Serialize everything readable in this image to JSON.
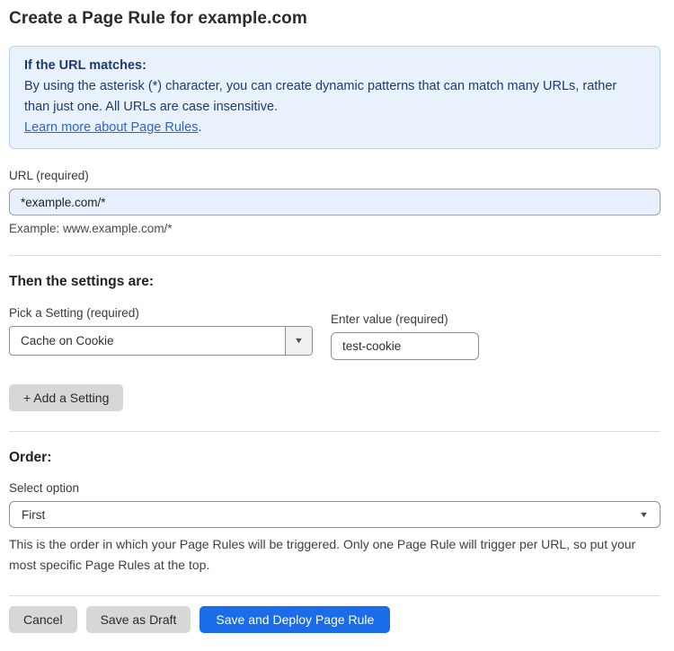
{
  "page": {
    "title": "Create a Page Rule for example.com"
  },
  "info_box": {
    "heading": "If the URL matches:",
    "body": "By using the asterisk (*) character, you can create dynamic patterns that can match many URLs, rather than just one. All URLs are case insensitive.",
    "link_label": "Learn more about Page Rules",
    "link_suffix": "."
  },
  "url_field": {
    "label": "URL (required)",
    "value": "*example.com/*",
    "example": "Example: www.example.com/*"
  },
  "settings_section": {
    "heading": "Then the settings are:",
    "setting_select": {
      "label": "Pick a Setting (required)",
      "value": "Cache on Cookie"
    },
    "value_field": {
      "label": "Enter value (required)",
      "value": "test-cookie"
    },
    "add_setting_label": "+ Add a Setting"
  },
  "order_section": {
    "heading": "Order:",
    "select_label": "Select option",
    "selected_option": "First",
    "help_text": "This is the order in which your Page Rules will be triggered. Only one Page Rule will trigger per URL, so put your most specific Page Rules at the top."
  },
  "footer": {
    "cancel_label": "Cancel",
    "save_draft_label": "Save as Draft",
    "deploy_label": "Save and Deploy Page Rule"
  },
  "icons": {
    "chevron_down": "▼"
  },
  "colors": {
    "info_bg": "#e9f2fc",
    "info_border": "#b5d5f2",
    "info_text": "#1d3c6d",
    "link_blue": "#2c64d4",
    "url_input_bg": "#e8f0fe",
    "primary_blue": "#1a6ce8",
    "button_gray": "#d7d7d7"
  }
}
